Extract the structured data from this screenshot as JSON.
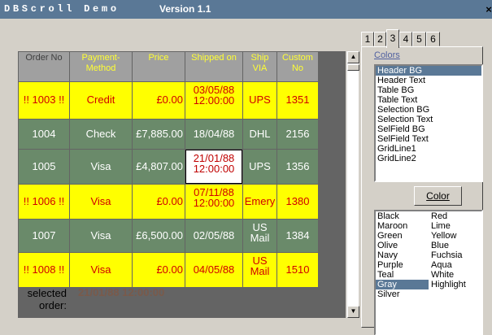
{
  "window": {
    "title_app": "DBScroll Demo",
    "title_version": "Version 1.1",
    "close_glyph": "×"
  },
  "grid": {
    "columns": [
      "Order No",
      "Payment-Method",
      "Price",
      "Shipped on",
      "Ship VIA",
      "Custom No"
    ],
    "rows": [
      {
        "style": "yellow",
        "order": "!! 1003 !!",
        "payment": "Credit",
        "price": "£0.00",
        "shipped": "03/05/88 12:00:00",
        "via": "UPS",
        "custom": "1351"
      },
      {
        "style": "green",
        "order": "1004",
        "payment": "Check",
        "price": "£7,885.00",
        "shipped": "18/04/88",
        "via": "DHL",
        "custom": "2156"
      },
      {
        "style": "green",
        "order": "1005",
        "payment": "Visa",
        "price": "£4,807.00",
        "shipped": "21/01/88 12:00:00",
        "via": "UPS",
        "custom": "1356",
        "selected_cell": "shipped"
      },
      {
        "style": "yellow",
        "order": "!! 1006 !!",
        "payment": "Visa",
        "price": "£0.00",
        "shipped": "07/11/88 12:00:00",
        "via": "Emery",
        "custom": "1380"
      },
      {
        "style": "green",
        "order": "1007",
        "payment": "Visa",
        "price": "£6,500.00",
        "shipped": "02/05/88",
        "via": "US Mail",
        "custom": "1384"
      },
      {
        "style": "yellow",
        "order": "!! 1008 !!",
        "payment": "Visa",
        "price": "£0.00",
        "shipped": "04/05/88",
        "via": "US Mail",
        "custom": "1510"
      }
    ]
  },
  "footer": {
    "label": "selected order:",
    "value": "21/01/88 12:00:00"
  },
  "tabs": {
    "labels": [
      "1",
      "2",
      "3",
      "4",
      "5",
      "6"
    ],
    "active_index": 2
  },
  "colors_panel": {
    "label": "Colors",
    "items": [
      "Header BG",
      "Header Text",
      "Table BG",
      "Table Text",
      "Selection BG",
      "Selection Text",
      "SelField BG",
      "SelField Text",
      "GridLine1",
      "GridLine2"
    ],
    "selected_index": 0,
    "color_button_label": "Color",
    "color_names": [
      "Black",
      "Maroon",
      "Green",
      "Olive",
      "Navy",
      "Purple",
      "Teal",
      "Gray",
      "Silver",
      "Red",
      "Lime",
      "Yellow",
      "Blue",
      "Fuchsia",
      "Aqua",
      "White",
      "Highlight"
    ],
    "selected_color": "Gray"
  },
  "palette": {
    "titlebar": "#5a7896",
    "row_yellow": "#ffff00",
    "row_green": "#6a8a6a",
    "header_bg": "#a0a0a0",
    "header_text": "#ffff33",
    "selection": "#5a7896"
  },
  "icons": {
    "scroll_up": "scroll-up-arrow-icon",
    "scroll_down": "scroll-down-arrow-icon",
    "close": "close-icon"
  }
}
